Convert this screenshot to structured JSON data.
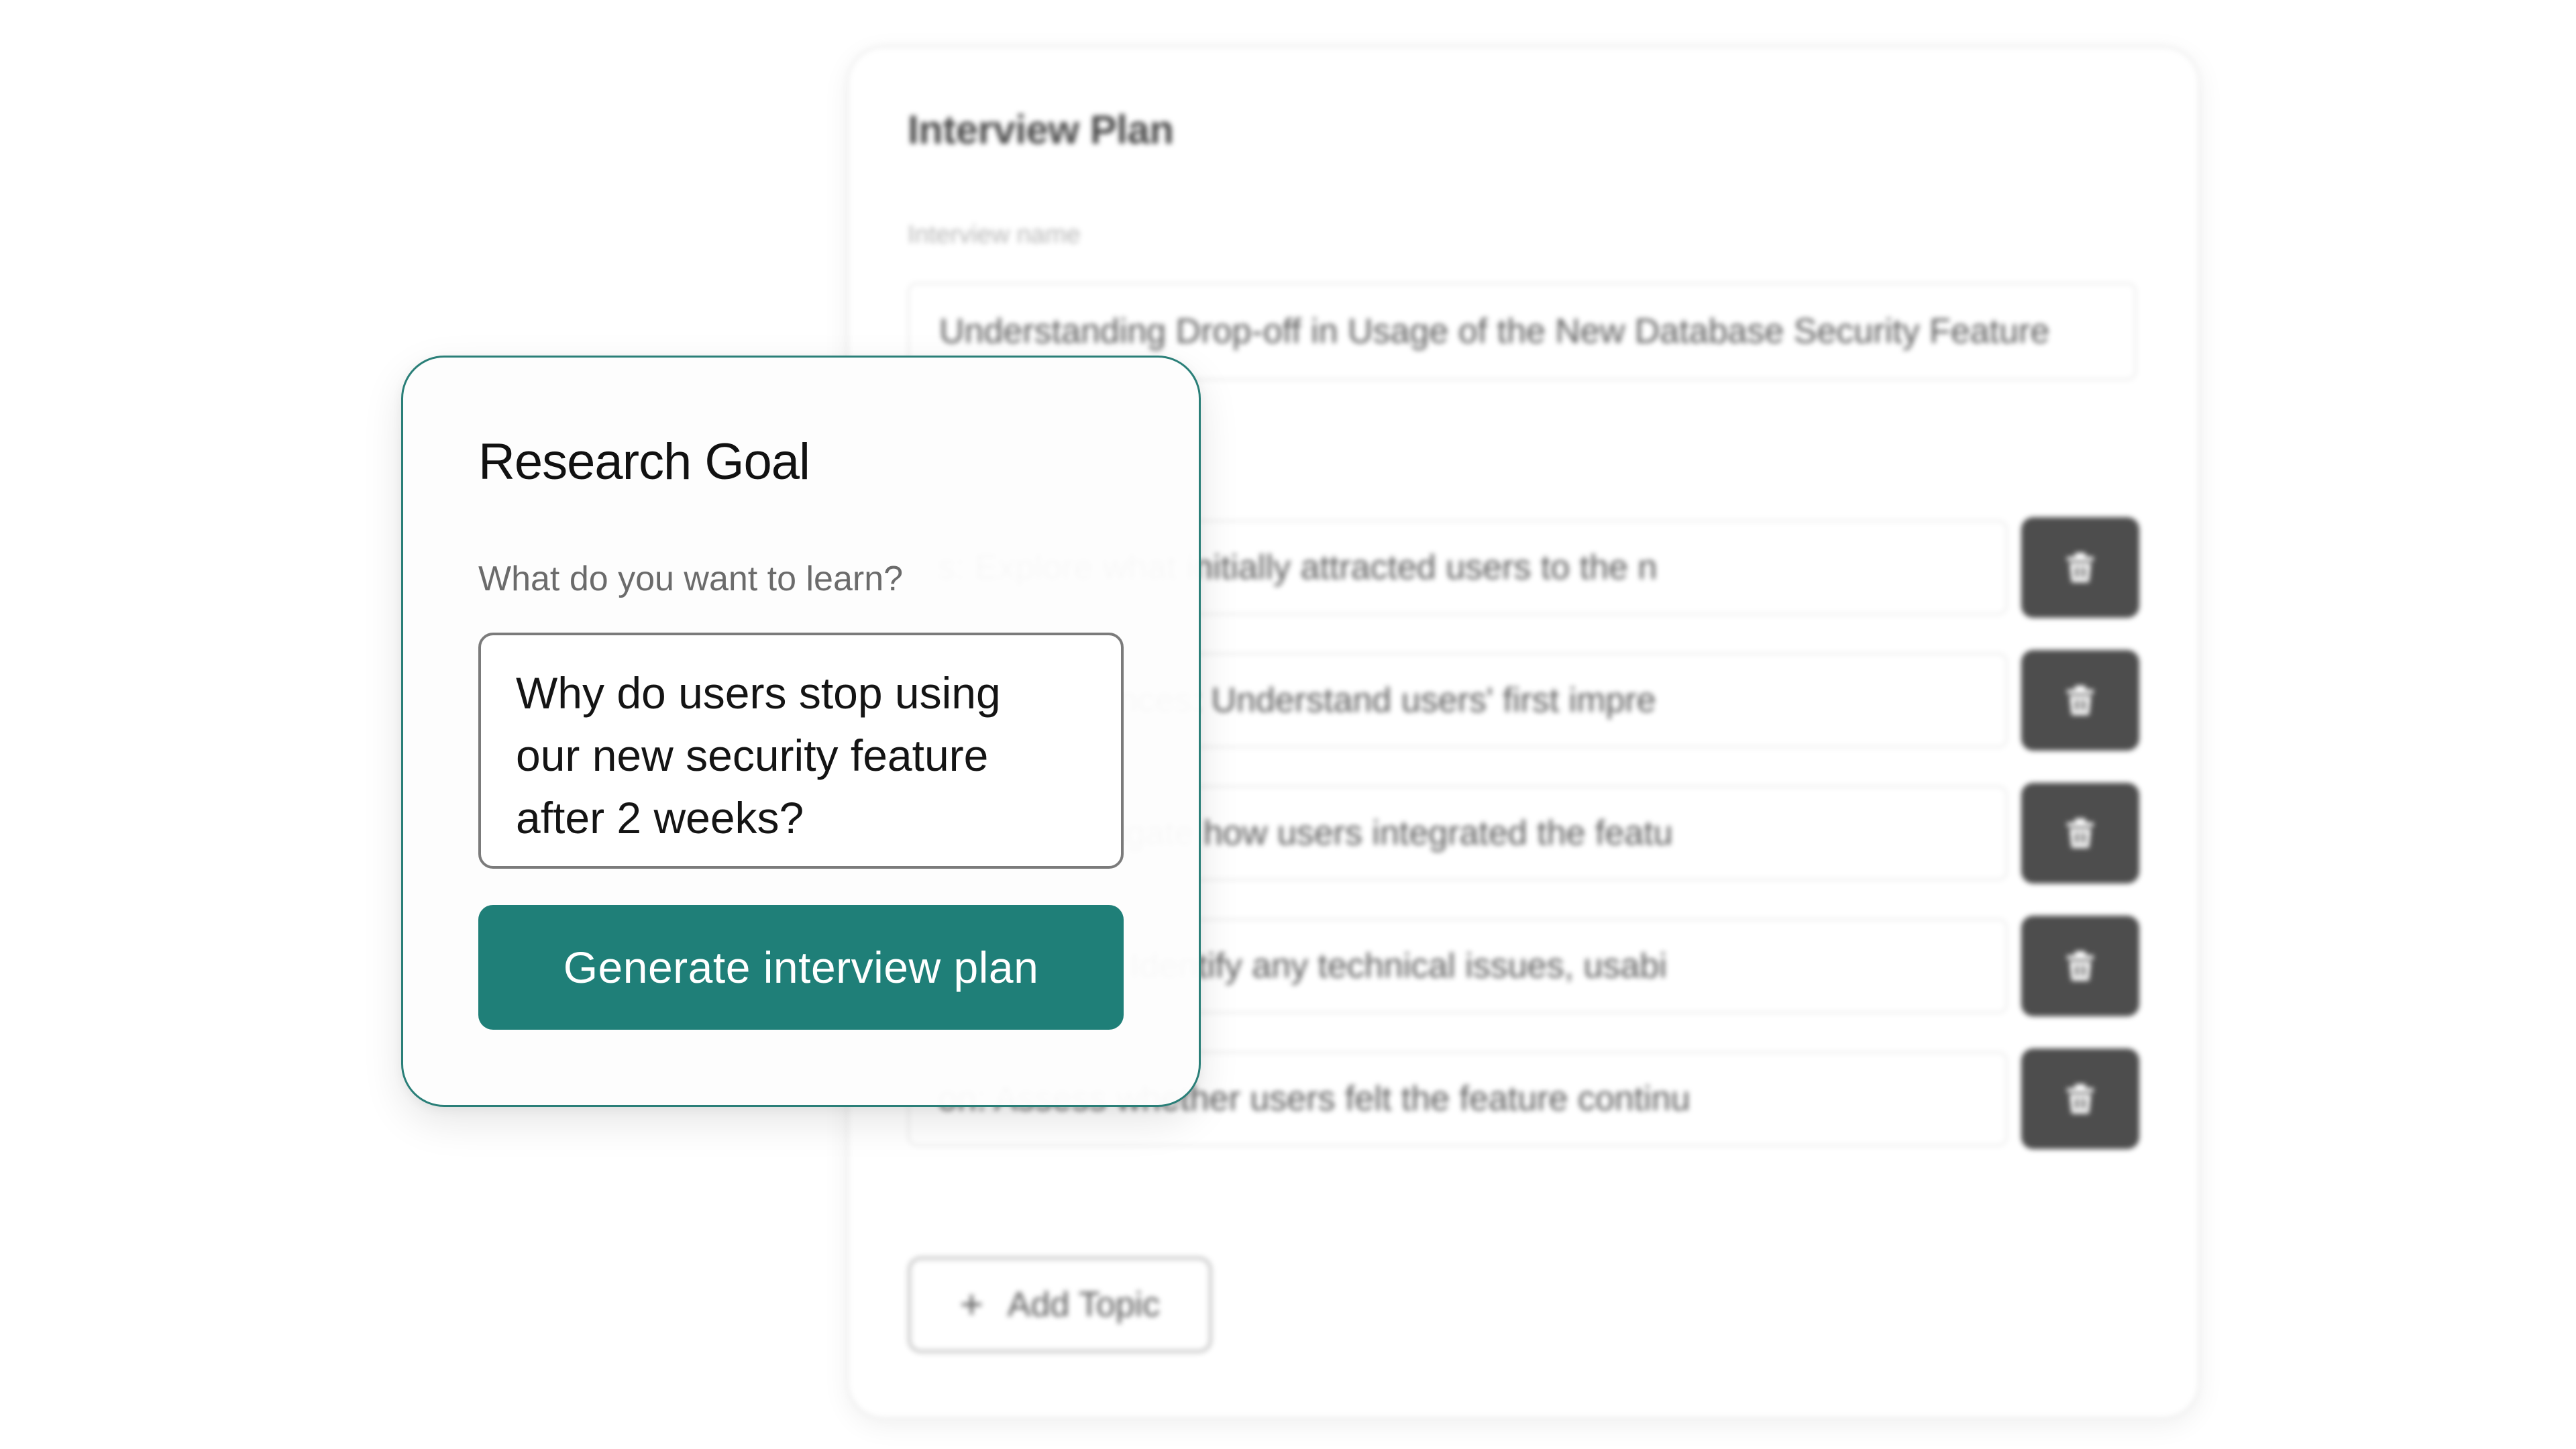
{
  "interview_plan": {
    "title": "Interview Plan",
    "name_label": "Interview name",
    "name_value": "Understanding Drop-off in Usage of the New Database Security Feature",
    "topics": [
      {
        "text": "s: Explore what initially attracted users to the n"
      },
      {
        "text": "first experiences: Understand users' first impre"
      },
      {
        "text": "erns: Investigate how users integrated the featu"
      },
      {
        "text": "frustrations: Identify any technical issues, usabi"
      },
      {
        "text": "on: Assess whether users felt the feature continu"
      }
    ],
    "add_topic_label": "Add Topic"
  },
  "research_goal": {
    "title": "Research Goal",
    "question_label": "What do you want to learn?",
    "input_lines": [
      "Why do users stop using",
      "our new security feature",
      "after 2 weeks?"
    ],
    "generate_label": "Generate interview plan"
  },
  "colors": {
    "accent": "#1f7f78",
    "card_border": "#2a7f78",
    "delete_button": "#4d4d4d"
  },
  "icons": {
    "delete": "trash-icon",
    "add": "plus-icon"
  }
}
